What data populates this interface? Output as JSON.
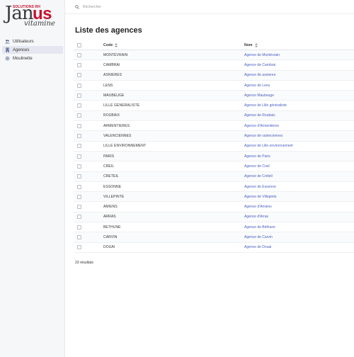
{
  "logo": {
    "solutions": "SOLUTIONS RH",
    "ja": "Jan",
    "us": "us",
    "vitamine": "vitamine"
  },
  "sidebar": {
    "items": [
      {
        "label": "Utilisateurs",
        "icon": "users-icon",
        "active": false
      },
      {
        "label": "Agences",
        "icon": "building-icon",
        "active": true
      },
      {
        "label": "Moulinette",
        "icon": "gear-icon",
        "active": false
      }
    ]
  },
  "search": {
    "placeholder": "Rechercher"
  },
  "page": {
    "title": "Liste des agences"
  },
  "table": {
    "headers": {
      "code": "Code",
      "nom": "Nom"
    },
    "rows": [
      {
        "code": "MONTÉVRAIN",
        "nom": "Agence de Montévrain"
      },
      {
        "code": "CAMBRAI",
        "nom": "Agence de Cambrai"
      },
      {
        "code": "ASNIERES",
        "nom": "Agence de asnieres"
      },
      {
        "code": "LENS",
        "nom": "Agence de Lens"
      },
      {
        "code": "MAUBEUGE",
        "nom": "Agence Maubeuge"
      },
      {
        "code": "LILLE GENERALISTE",
        "nom": "Agence de Lille généraliste"
      },
      {
        "code": "ROUBAIX",
        "nom": "Agence de Roubaix"
      },
      {
        "code": "ARMENTIERES",
        "nom": "Agence d'Armentières"
      },
      {
        "code": "VALENCIENNES",
        "nom": "Agence de valenciennes"
      },
      {
        "code": "LILLE ENVIRONNEMENT",
        "nom": "Agence de Lille environnement"
      },
      {
        "code": "PARIS",
        "nom": "Agence de Paris"
      },
      {
        "code": "CREIL",
        "nom": "Agence de Creil"
      },
      {
        "code": "CRETEIL",
        "nom": "Agence de Créteil"
      },
      {
        "code": "ESSONNE",
        "nom": "Agence de Essonne"
      },
      {
        "code": "VILLEPINTE",
        "nom": "Agence de Villepinte"
      },
      {
        "code": "AMIENS",
        "nom": "Agence d'Amiens"
      },
      {
        "code": "ARRAS",
        "nom": "Agence d'Arras"
      },
      {
        "code": "BETHUNE",
        "nom": "Agence de Béthune"
      },
      {
        "code": "CARVIN",
        "nom": "Agence de Carvin"
      },
      {
        "code": "DOUAI",
        "nom": "Agence de Douai"
      }
    ]
  },
  "footer": {
    "results": "23 résultats"
  },
  "colors": {
    "brand_red": "#c8102e",
    "link_blue": "#4a5fc1",
    "sidebar_bg": "#f6f7f9",
    "active_bg": "#e4e7ef"
  }
}
